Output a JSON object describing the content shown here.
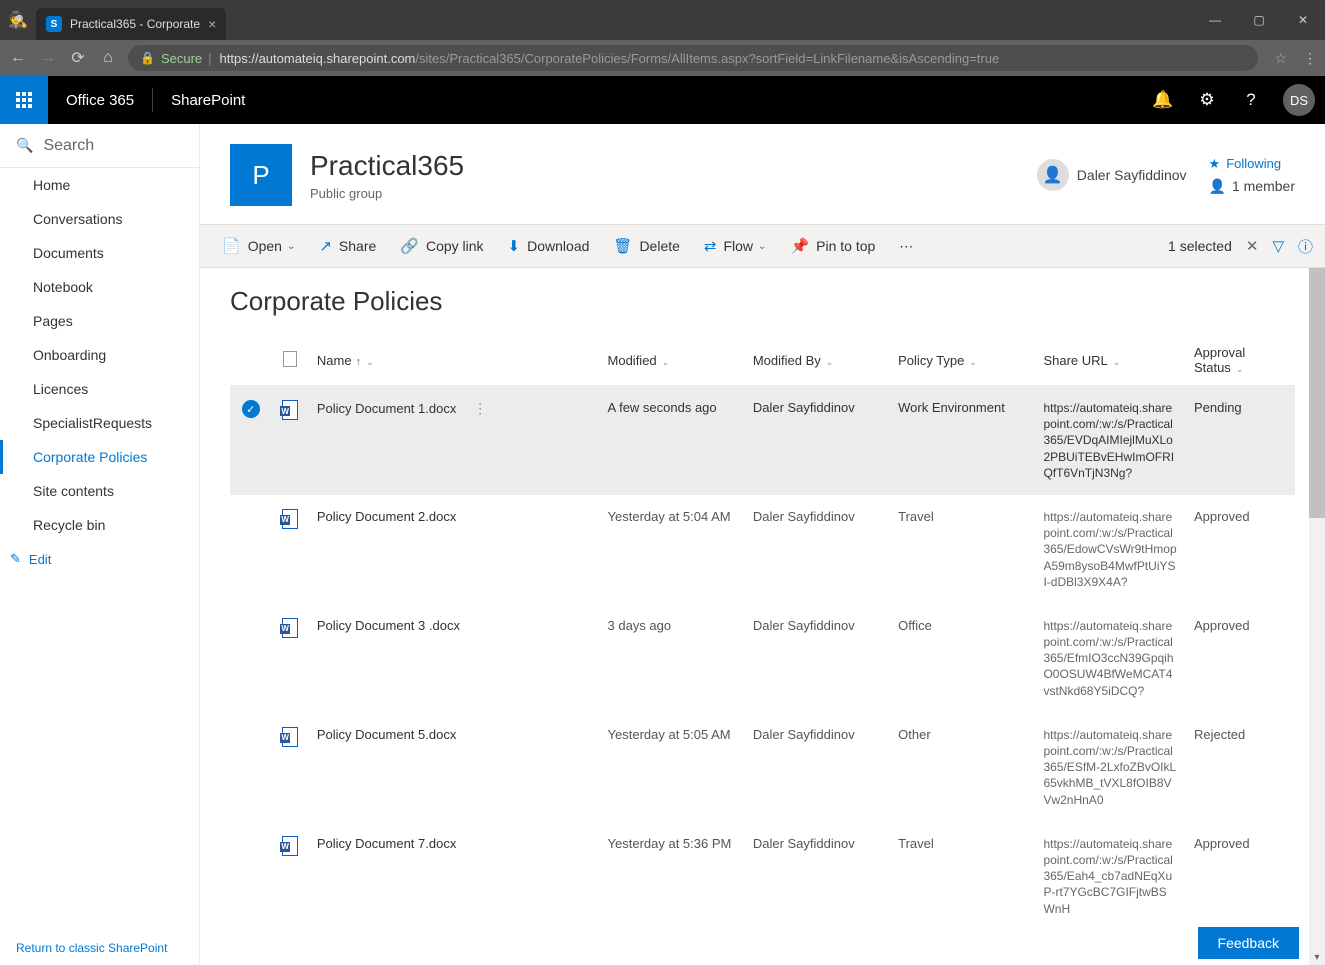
{
  "browser": {
    "tab_title": "Practical365 - Corporate",
    "url_secure_label": "Secure",
    "url_host": "https://automateiq.sharepoint.com",
    "url_path": "/sites/Practical365/CorporatePolicies/Forms/AllItems.aspx?sortField=LinkFilename&isAscending=true"
  },
  "o365": {
    "suite": "Office 365",
    "app": "SharePoint",
    "avatar_initials": "DS"
  },
  "search_label": "Search",
  "nav": {
    "items": [
      "Home",
      "Conversations",
      "Documents",
      "Notebook",
      "Pages",
      "Onboarding",
      "Licences",
      "SpecialistRequests",
      "Corporate Policies",
      "Site contents",
      "Recycle bin"
    ],
    "active_index": 8,
    "edit_label": "Edit",
    "footer": "Return to classic SharePoint"
  },
  "site": {
    "logo_letter": "P",
    "title": "Practical365",
    "subtitle": "Public group",
    "follow_label": "Following",
    "user_display": "Daler Sayfiddinov",
    "members_label": "1 member"
  },
  "cmdbar": {
    "open": "Open",
    "share": "Share",
    "copylink": "Copy link",
    "download": "Download",
    "delete": "Delete",
    "flow": "Flow",
    "pin": "Pin to top",
    "selected": "1 selected"
  },
  "list": {
    "title": "Corporate Policies",
    "columns": {
      "name": "Name",
      "modified": "Modified",
      "modifiedby": "Modified By",
      "policytype": "Policy Type",
      "shareurl": "Share URL",
      "approval": "Approval Status"
    },
    "rows": [
      {
        "selected": true,
        "name": "Policy Document 1.docx",
        "modified": "A few seconds ago",
        "modifiedby": "Daler Sayfiddinov",
        "policytype": "Work Environment",
        "shareurl": "https://automateiq.sharepoint.com/:w:/s/Practical365/EVDqAIMIejlMuXLo2PBUiTEBvEHwImOFRIQfT6VnTjN3Ng?",
        "approval": "Pending"
      },
      {
        "selected": false,
        "name": "Policy Document 2.docx",
        "modified": "Yesterday at 5:04 AM",
        "modifiedby": "Daler Sayfiddinov",
        "policytype": "Travel",
        "shareurl": "https://automateiq.sharepoint.com/:w:/s/Practical365/EdowCVsWr9tHmopA59m8ysoB4MwfPtUiYSI-dDBl3X9X4A?",
        "approval": "Approved"
      },
      {
        "selected": false,
        "name": "Policy Document 3 .docx",
        "modified": "3 days ago",
        "modifiedby": "Daler Sayfiddinov",
        "policytype": "Office",
        "shareurl": "https://automateiq.sharepoint.com/:w:/s/Practical365/EfmIO3ccN39GpqihO0OSUW4BfWeMCAT4vstNkd68Y5iDCQ?",
        "approval": "Approved"
      },
      {
        "selected": false,
        "name": "Policy Document 5.docx",
        "modified": "Yesterday at 5:05 AM",
        "modifiedby": "Daler Sayfiddinov",
        "policytype": "Other",
        "shareurl": "https://automateiq.sharepoint.com/:w:/s/Practical365/ESfM-2LxfoZBvOIkL65vkhMB_tVXL8fOIB8VVw2nHnA0",
        "approval": "Rejected"
      },
      {
        "selected": false,
        "name": "Policy Document 7.docx",
        "modified": "Yesterday at 5:36 PM",
        "modifiedby": "Daler Sayfiddinov",
        "policytype": "Travel",
        "shareurl": "https://automateiq.sharepoint.com/:w:/s/Practical365/Eah4_cb7adNEqXuP-rt7YGcBC7GIFjtwBSWnH",
        "approval": "Approved"
      }
    ]
  },
  "feedback_label": "Feedback"
}
